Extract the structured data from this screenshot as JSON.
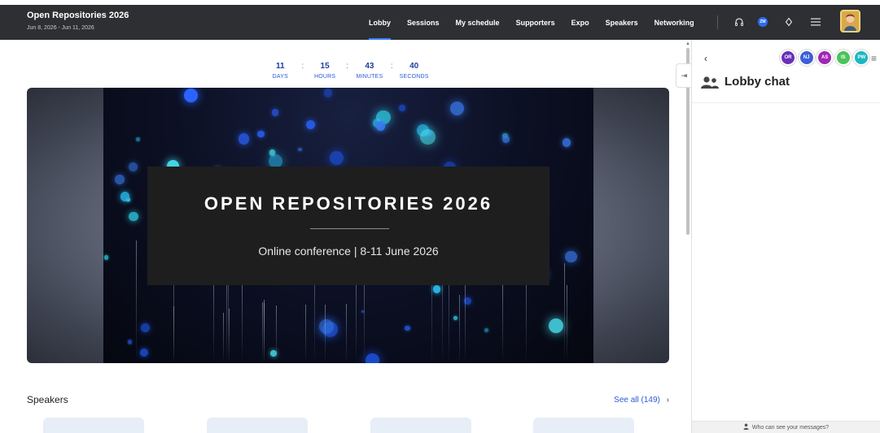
{
  "header": {
    "event_title": "Open Repositories 2026",
    "event_dates": "Jun 8, 2026 - Jun 11, 2026",
    "nav": [
      "Lobby",
      "Sessions",
      "My schedule",
      "Supporters",
      "Expo",
      "Speakers",
      "Networking"
    ],
    "active_nav": "Lobby",
    "zm_badge": "ZM",
    "icons": [
      "headphones-icon",
      "notifications-icon",
      "menu-icon"
    ]
  },
  "countdown": {
    "days": "11",
    "days_label": "DAYS",
    "hours": "15",
    "hours_label": "HOURS",
    "minutes": "43",
    "minutes_label": "MINUTES",
    "seconds": "40",
    "seconds_label": "SECONDS",
    "separator": ":"
  },
  "banner": {
    "title": "OPEN REPOSITORIES 2026",
    "subtitle": "Online conference | 8-11 June 2026"
  },
  "speakers": {
    "heading": "Speakers",
    "see_all": "See all (149)"
  },
  "chat": {
    "title": "Lobby chat",
    "participants": [
      {
        "initials": "OR",
        "color": "#6a2fb8"
      },
      {
        "initials": "NJ",
        "color": "#3b5fd9"
      },
      {
        "initials": "AS",
        "color": "#a026b5"
      },
      {
        "initials": "IS",
        "color": "#49c45a"
      },
      {
        "initials": "PW",
        "color": "#1ab8c2"
      }
    ],
    "footer": "Who can see your messages?"
  },
  "colors": {
    "accent": "#2e5ad6",
    "topbar": "#2e2f33"
  }
}
